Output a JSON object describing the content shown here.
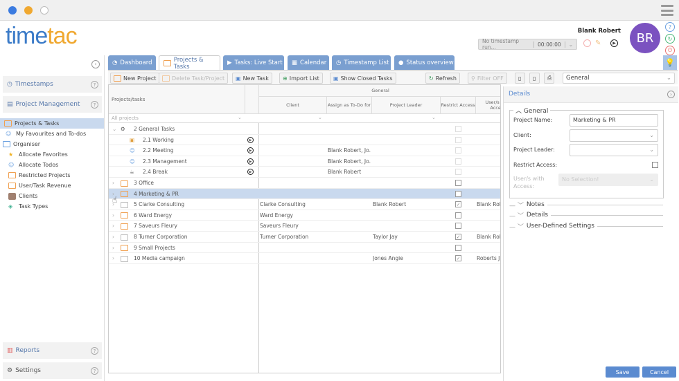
{
  "logo": {
    "part1": "time",
    "part2": "tac"
  },
  "user": {
    "name": "Blank Robert",
    "initials": "BR"
  },
  "timestamp": {
    "status": "No timestamp run...",
    "time": "00:00:00"
  },
  "sidebar": {
    "sections": [
      {
        "label": "Timestamps"
      },
      {
        "label": "Project Management"
      },
      {
        "label": "Reports"
      },
      {
        "label": "Settings"
      }
    ],
    "items": [
      {
        "label": "Projects & Tasks"
      },
      {
        "label": "My Favourites and To-dos"
      },
      {
        "label": "Organiser"
      },
      {
        "label": "Allocate Favorites"
      },
      {
        "label": "Allocate Todos"
      },
      {
        "label": "Restricted Projects"
      },
      {
        "label": "User/Task Revenue"
      },
      {
        "label": "Clients"
      },
      {
        "label": "Task Types"
      }
    ]
  },
  "tabs": [
    {
      "label": "Dashboard"
    },
    {
      "label": "Projects & Tasks"
    },
    {
      "label": "Tasks: Live Start"
    },
    {
      "label": "Calendar"
    },
    {
      "label": "Timestamp List"
    },
    {
      "label": "Status overview"
    }
  ],
  "toolbar": {
    "new_project": "New Project",
    "delete": "Delete Task/Project",
    "new_task": "New Task",
    "import": "Import List",
    "show_closed": "Show Closed Tasks",
    "refresh": "Refresh",
    "filter": "Filter OFF",
    "view": "General"
  },
  "grid": {
    "group": "General",
    "headers": {
      "tree": "Projects/tasks",
      "client": "Client",
      "assign": "Assign as To-Do for",
      "leader": "Project Leader",
      "restrict": "Restrict Access",
      "users": "User/s with Access"
    },
    "filter_placeholder": "All projects",
    "rows": [
      {
        "name": "2 General Tasks",
        "client": "",
        "assign": "",
        "leader": "",
        "restrict": false,
        "users": ""
      },
      {
        "name": "2.1 Working",
        "client": "",
        "assign": "",
        "leader": "",
        "restrict": false,
        "users": ""
      },
      {
        "name": "2.2 Meeting",
        "client": "",
        "assign": "Blank Robert, Jo...",
        "leader": "",
        "restrict": false,
        "users": ""
      },
      {
        "name": "2.3 Management",
        "client": "",
        "assign": "Blank Robert, Jo...",
        "leader": "",
        "restrict": false,
        "users": ""
      },
      {
        "name": "2.4 Break",
        "client": "",
        "assign": "Blank Robert",
        "leader": "",
        "restrict": false,
        "users": ""
      },
      {
        "name": "3 Office",
        "client": "",
        "assign": "",
        "leader": "",
        "restrict": false,
        "users": ""
      },
      {
        "name": "4 Marketing & PR",
        "client": "",
        "assign": "",
        "leader": "",
        "restrict": false,
        "users": ""
      },
      {
        "name": "5 Clarke Consulting",
        "client": "Clarke Consulting",
        "assign": "",
        "leader": "Blank Robert",
        "restrict": true,
        "users": "Blank Rob"
      },
      {
        "name": "6 Ward Energy",
        "client": "Ward Energy",
        "assign": "",
        "leader": "",
        "restrict": false,
        "users": ""
      },
      {
        "name": "7 Saveurs Fleury",
        "client": "Saveurs Fleury",
        "assign": "",
        "leader": "",
        "restrict": false,
        "users": ""
      },
      {
        "name": "8 Turner Corporation",
        "client": "Turner Corporation",
        "assign": "",
        "leader": "Taylor Jay",
        "restrict": true,
        "users": "Blank Rob"
      },
      {
        "name": "9 Small Projects",
        "client": "",
        "assign": "",
        "leader": "",
        "restrict": false,
        "users": ""
      },
      {
        "name": "10 Media campaign",
        "client": "",
        "assign": "",
        "leader": "Jones Angie",
        "restrict": true,
        "users": "Roberts Ji"
      }
    ]
  },
  "details": {
    "title": "Details",
    "general": "General",
    "project_name_label": "Project Name:",
    "project_name": "Marketing & PR",
    "client_label": "Client:",
    "leader_label": "Project Leader:",
    "restrict_label": "Restrict Access:",
    "users_label": "User/s with Access:",
    "users_placeholder": "No Selection!",
    "notes": "Notes",
    "details": "Details",
    "user_defined": "User-Defined Settings",
    "save": "Save",
    "cancel": "Cancel"
  }
}
